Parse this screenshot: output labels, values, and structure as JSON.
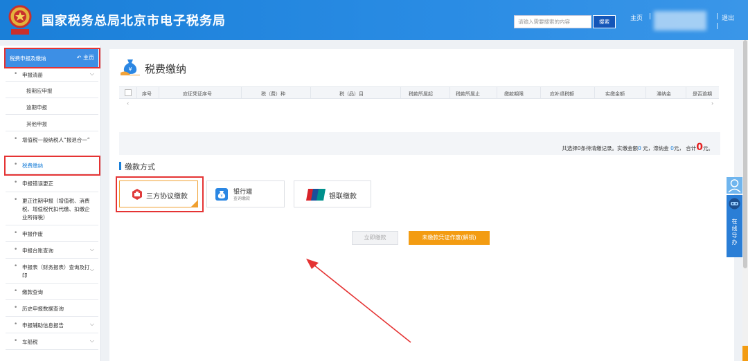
{
  "header": {
    "title": "国家税务总局北京市电子税务局",
    "search_placeholder": "请输入需要搜索的内容",
    "search_button": "搜索",
    "home": "主页",
    "separator": "|",
    "logout": "退出",
    "colors": {
      "bar": "#1a7fd8",
      "search_button": "#1456b8"
    }
  },
  "sidebar": {
    "section_title": "税费申报及缴纳",
    "home_link": "主页",
    "items": [
      {
        "label": "申报清册",
        "has_chevron": true
      },
      {
        "label": "按期应申报"
      },
      {
        "label": "逾期申报"
      },
      {
        "label": "其他申报"
      },
      {
        "label": "增值税一般纳税人“报退合一”"
      },
      {
        "label": "税费缴纳",
        "active": true
      },
      {
        "label": "申报错误更正"
      },
      {
        "label": "更正往期申报（增值税、消费税、增值税代扣代缴、扣缴企业所得税）"
      },
      {
        "label": "申报作废"
      },
      {
        "label": "申报台账查询",
        "has_chevron": true
      },
      {
        "label": "申报表（财务报表）查询及打印",
        "has_chevron": true
      },
      {
        "label": "缴款查询"
      },
      {
        "label": "历史申报数据查询"
      },
      {
        "label": "申报辅助信息报告",
        "has_chevron": true
      },
      {
        "label": "车船税",
        "has_chevron": true
      }
    ]
  },
  "main": {
    "page_title": "税费缴纳",
    "table_headers": [
      "序号",
      "应征凭证序号",
      "税（费）种",
      "税（品）目",
      "税款所属起",
      "税款所属止",
      "缴款期限",
      "应补退税额",
      "实缴金额",
      "滞纳金",
      "是否逾期"
    ],
    "summary": {
      "prefix": "共选择0条待清缴记录。实缴金额",
      "paid_amount": "0",
      "mid1": " 元，滞纳金 ",
      "late_fee": "0",
      "mid2": "元，  合计",
      "total": "0",
      "suffix": "元。"
    },
    "payment_section_title": "缴款方式",
    "payment_methods": [
      {
        "label": "三方协议缴款",
        "selected": true
      },
      {
        "label": "银行端",
        "sub": "查询缴款"
      },
      {
        "label": "银联缴款"
      }
    ],
    "buttons": {
      "pay_now": "立即缴款",
      "void_unpaid": "未缴款凭证作废(解锁)"
    },
    "colors": {
      "accent_orange": "#f39c12",
      "highlight_red": "#e53333",
      "total_red": "#e52222"
    }
  },
  "helper": {
    "label": [
      "在",
      "线",
      "导",
      "办"
    ]
  }
}
